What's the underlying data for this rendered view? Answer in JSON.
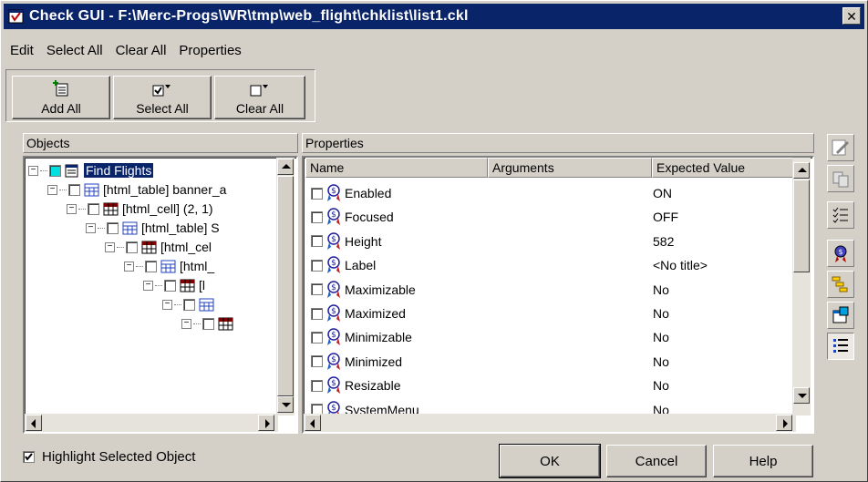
{
  "window": {
    "title": "Check GUI - F:\\Merc-Progs\\WR\\tmp\\web_flight\\chklist\\list1.ckl",
    "close_glyph": "✕"
  },
  "menu": [
    "Edit",
    "Select All",
    "Clear All",
    "Properties"
  ],
  "toolbar": {
    "add_all": "Add All",
    "select_all": "Select All",
    "clear_all": "Clear All"
  },
  "objects_panel": {
    "title": "Objects",
    "tree": [
      {
        "level": 0,
        "label": "Find Flights",
        "selected": true,
        "icon": "window-icon"
      },
      {
        "level": 1,
        "label": "[html_table] banner_a",
        "icon": "table-icon"
      },
      {
        "level": 2,
        "label": "[html_cell] (2, 1)",
        "icon": "cell-icon"
      },
      {
        "level": 3,
        "label": "[html_table] S",
        "icon": "table-icon"
      },
      {
        "level": 4,
        "label": "[html_cel",
        "icon": "cell-icon"
      },
      {
        "level": 5,
        "label": "[html_",
        "icon": "table-icon"
      },
      {
        "level": 6,
        "label": "[l",
        "icon": "cell-icon"
      },
      {
        "level": 7,
        "label": "",
        "icon": "table-icon"
      },
      {
        "level": 8,
        "label": "",
        "icon": "cell-icon"
      }
    ]
  },
  "properties_panel": {
    "title": "Properties",
    "columns": [
      "Name",
      "Arguments",
      "Expected Value"
    ],
    "rows": [
      {
        "name": "Enabled",
        "arguments": "",
        "expected": "ON"
      },
      {
        "name": "Focused",
        "arguments": "",
        "expected": "OFF"
      },
      {
        "name": "Height",
        "arguments": "",
        "expected": "582"
      },
      {
        "name": "Label",
        "arguments": "",
        "expected": "<No title>"
      },
      {
        "name": "Maximizable",
        "arguments": "",
        "expected": "No"
      },
      {
        "name": "Maximized",
        "arguments": "",
        "expected": "No"
      },
      {
        "name": "Minimizable",
        "arguments": "",
        "expected": "No"
      },
      {
        "name": "Minimized",
        "arguments": "",
        "expected": "No"
      },
      {
        "name": "Resizable",
        "arguments": "",
        "expected": "No"
      },
      {
        "name": "SystemMenu",
        "arguments": "",
        "expected": "No"
      }
    ]
  },
  "side_toolbar": [
    "edit-expected-icon",
    "compare-icon",
    "checklist-icon",
    "property-icon",
    "hierarchy-icon",
    "window-properties-icon",
    "list-view-icon"
  ],
  "options": {
    "highlight_selected": "Highlight Selected Object",
    "highlight_checked": true
  },
  "buttons": {
    "ok": "OK",
    "cancel": "Cancel",
    "help": "Help"
  },
  "colors": {
    "titlebar": "#0a246a",
    "face": "#d4d0c8",
    "selection": "#0a246a"
  }
}
